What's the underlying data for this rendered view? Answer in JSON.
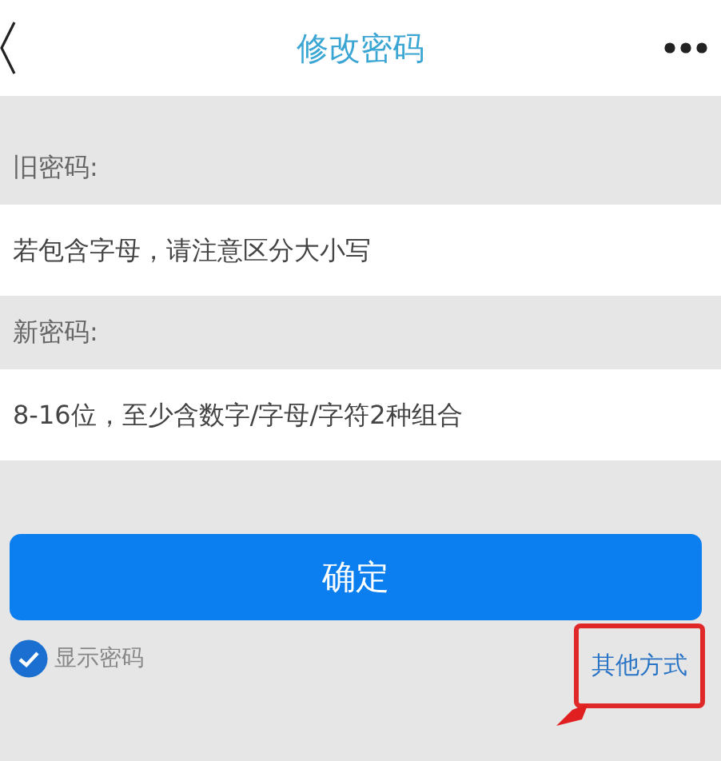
{
  "header": {
    "title": "修改密码"
  },
  "fields": [
    {
      "label": "旧密码:",
      "placeholder": "若包含字母，请注意区分大小写"
    },
    {
      "label": "新密码:",
      "placeholder": "8-16位，至少含数字/字母/字符2种组合"
    }
  ],
  "confirm_button": "确定",
  "show_password": {
    "label": "显示密码",
    "checked": true
  },
  "other_method": {
    "label": "其他方式",
    "highlighted": true
  }
}
